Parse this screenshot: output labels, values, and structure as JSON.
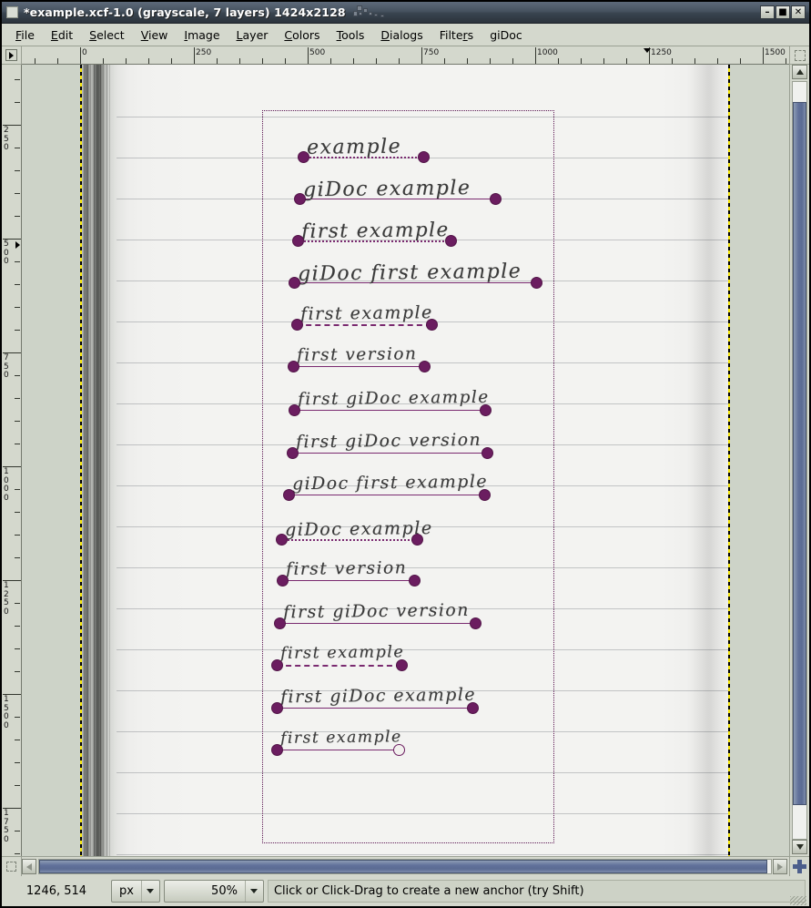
{
  "window": {
    "title": "*example.xcf-1.0 (grayscale, 7 layers) 1424x2128",
    "minimize_label": "–",
    "maximize_label": "■",
    "close_label": "✕"
  },
  "menubar": {
    "items": [
      {
        "label": "File",
        "accel": "F"
      },
      {
        "label": "Edit",
        "accel": "E"
      },
      {
        "label": "Select",
        "accel": "S"
      },
      {
        "label": "View",
        "accel": "V"
      },
      {
        "label": "Image",
        "accel": "I"
      },
      {
        "label": "Layer",
        "accel": "L"
      },
      {
        "label": "Colors",
        "accel": "C"
      },
      {
        "label": "Tools",
        "accel": "T"
      },
      {
        "label": "Dialogs",
        "accel": "D"
      },
      {
        "label": "Filters",
        "accel": "r"
      },
      {
        "label": "giDoc",
        "accel": ""
      }
    ]
  },
  "rulers": {
    "unit": "px",
    "horizontal_labels": [
      "0",
      "250",
      "500",
      "750",
      "1000",
      "1250",
      "1500"
    ],
    "vertical_labels": [
      "250",
      "500",
      "750",
      "1000",
      "1250",
      "1500",
      "1750"
    ],
    "horizontal_marker_value": "1246",
    "vertical_marker_value": "514"
  },
  "canvas": {
    "image_width": "1424",
    "image_height": "2128",
    "lines": [
      "example",
      "giDoc example",
      "first example",
      "giDoc first example",
      "first example",
      "first version",
      "first giDoc example",
      "first giDoc version",
      "giDoc first example",
      "giDoc example",
      "first version",
      "first giDoc version",
      "first example",
      "first giDoc example",
      "first example"
    ],
    "colors": {
      "anchor": "#6b1d60",
      "baseline": "#7a2a70",
      "selection": "#5e1a55",
      "canvas_boundary": "#f5e505"
    }
  },
  "statusbar": {
    "pointer_position": "1246, 514",
    "unit_value": "px",
    "zoom_value": "50%",
    "message": "Click or Click-Drag to create a new anchor (try Shift)"
  },
  "scrollbars": {
    "vertical_up_icon": "triangle-up-icon",
    "vertical_down_icon": "triangle-down-icon",
    "horizontal_left_icon": "triangle-left-icon",
    "horizontal_right_icon": "triangle-right-icon",
    "navigate_icon": "navigate-cross-icon"
  }
}
